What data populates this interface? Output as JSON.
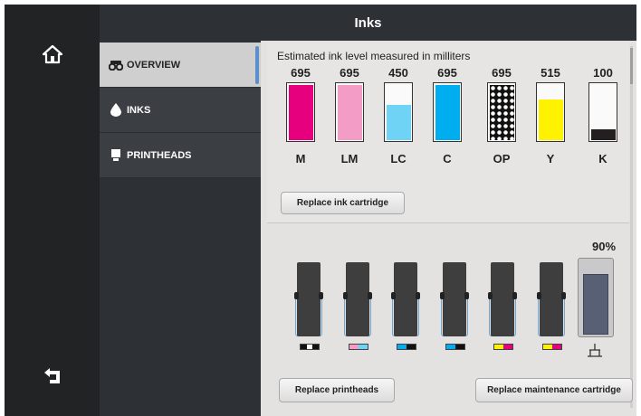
{
  "window": {
    "title": "Inks"
  },
  "rail": {
    "home_icon": "home-icon",
    "back_icon": "back-arrow-icon"
  },
  "sidebar": {
    "items": [
      {
        "label": "OVERVIEW",
        "icon": "overview-icon",
        "active": true
      },
      {
        "label": "INKS",
        "icon": "ink-drop-icon",
        "active": false
      },
      {
        "label": "PRINTHEADS",
        "icon": "printhead-icon",
        "active": false
      }
    ]
  },
  "inks": {
    "caption": "Estimated ink level measured in milliters",
    "cartridges": [
      {
        "label": "M",
        "value": "695",
        "level": 1.0,
        "color": "#e6007e"
      },
      {
        "label": "LM",
        "value": "695",
        "level": 1.0,
        "color": "#f39cc5"
      },
      {
        "label": "LC",
        "value": "450",
        "level": 0.65,
        "color": "#6ed3f4"
      },
      {
        "label": "C",
        "value": "695",
        "level": 1.0,
        "color": "#00aeef"
      },
      {
        "label": "OP",
        "value": "695",
        "level": 1.0,
        "color": "pattern"
      },
      {
        "label": "Y",
        "value": "515",
        "level": 0.74,
        "color": "#fff200"
      },
      {
        "label": "K",
        "value": "100",
        "level": 0.22,
        "color": "#231f20"
      }
    ],
    "replace_label": "Replace ink cartridge"
  },
  "printheads": {
    "heads": [
      {
        "colors": [
          "#111111",
          "#ffffff",
          "#111111"
        ]
      },
      {
        "colors": [
          "#f39cc5",
          "#6ed3f4"
        ]
      },
      {
        "colors": [
          "#00aeef",
          "#111111"
        ]
      },
      {
        "colors": [
          "#00aeef",
          "#111111"
        ]
      },
      {
        "colors": [
          "#fff200",
          "#e6007e"
        ]
      },
      {
        "colors": [
          "#fff200",
          "#e6007e"
        ]
      }
    ],
    "maintenance_percent": "90%",
    "maintenance_level": 0.9,
    "replace_printheads_label": "Replace printheads",
    "replace_maintenance_label": "Replace maintenance cartridge"
  }
}
